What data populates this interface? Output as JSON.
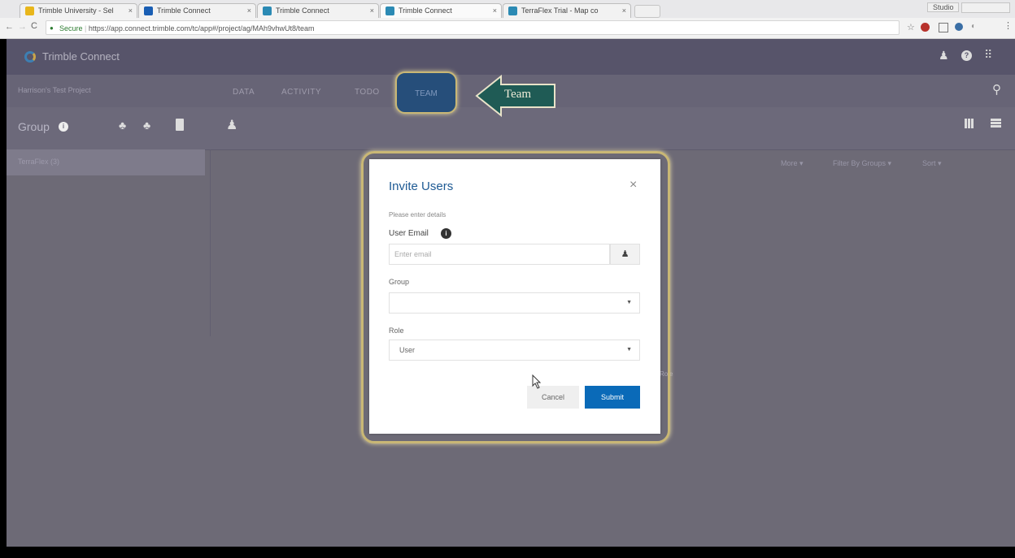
{
  "browser": {
    "tabs": [
      {
        "title": "Trimble University - Sel",
        "favicon_color": "#e8b61b",
        "active": false
      },
      {
        "title": "Trimble Connect",
        "favicon_color": "#1a5fb4",
        "active": false
      },
      {
        "title": "Trimble Connect",
        "favicon_color": "#2b8ab4",
        "active": false
      },
      {
        "title": "Trimble Connect",
        "favicon_color": "#2b8ab4",
        "active": true
      },
      {
        "title": "TerraFlex Trial - Map co",
        "favicon_color": "#2b8ab4",
        "active": false
      }
    ],
    "window_controls": "Studio",
    "secure_label": "Secure",
    "url": "https://app.connect.trimble.com/tc/app#/project/ag/MAh9vhwUt8/team"
  },
  "app": {
    "logo_text": "Trimble Connect",
    "project_name": "Harrison's Test Project",
    "tabs": [
      "DATA",
      "ACTIVITY",
      "TODO",
      "TEAM"
    ],
    "group_label": "Group",
    "sidebar_groups": [
      "TerraFlex (3)"
    ],
    "toolbar_dropdowns": [
      "More ▾",
      "Filter By Groups ▾",
      "Sort ▾"
    ]
  },
  "callout": {
    "label": "Team"
  },
  "modal": {
    "title": "Invite Users",
    "instructions": "Please enter details",
    "email_label": "User Email",
    "email_placeholder": "Enter email",
    "group_label": "Group",
    "group_value": "",
    "role_label": "Role",
    "role_value": "User",
    "cancel_label": "Cancel",
    "submit_label": "Submit",
    "close_label": "×"
  },
  "background_text": "Role",
  "colors": {
    "accent": "#0a6ab8",
    "highlight": "#c9b775",
    "callout": "#1f5b55"
  }
}
